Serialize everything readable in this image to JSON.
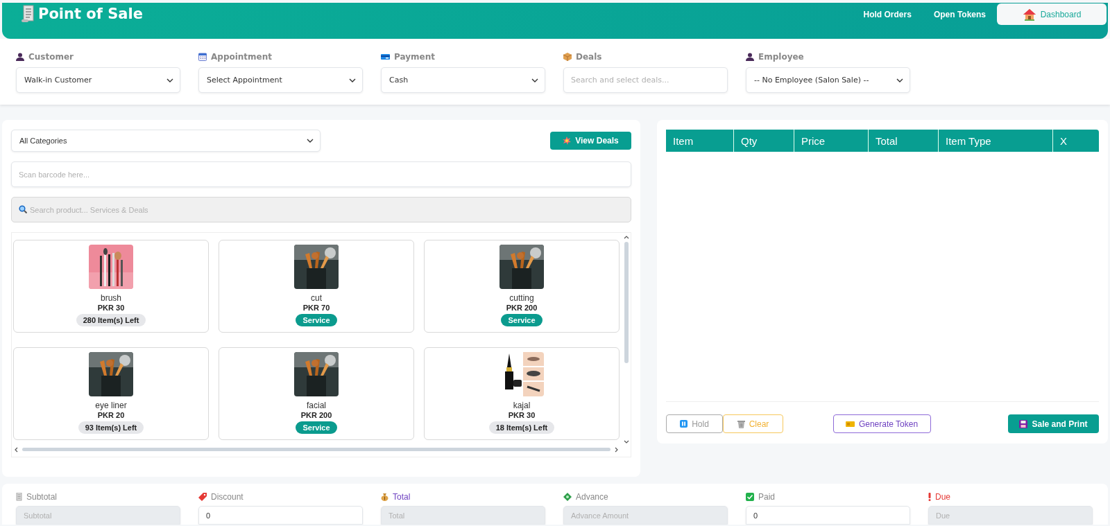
{
  "header": {
    "title": "Point of Sale",
    "nav": [
      {
        "label": "Hold Orders",
        "kind": "link"
      },
      {
        "label": "Open Tokens",
        "kind": "link"
      },
      {
        "label": "Dashboard",
        "kind": "button"
      }
    ]
  },
  "filters": [
    {
      "label": "Customer",
      "kind": "select",
      "value": "Walk-in Customer"
    },
    {
      "label": "Appointment",
      "kind": "select",
      "value": "Select Appointment"
    },
    {
      "label": "Payment",
      "kind": "select",
      "value": "Cash"
    },
    {
      "label": "Deals",
      "kind": "search",
      "placeholder": "Search and select deals..."
    },
    {
      "label": "Employee",
      "kind": "select",
      "value": "-- No Employee (Salon Sale) --"
    }
  ],
  "products_panel": {
    "category": "All Categories",
    "view_deals": "View Deals",
    "barcode_placeholder": "Scan barcode here...",
    "search_placeholder": "Search product... Services & Deals",
    "products": [
      {
        "name": "brush",
        "price": "PKR 30",
        "kind": "stock",
        "badge": "280 Item(s) Left"
      },
      {
        "name": "cut",
        "price": "PKR 70",
        "kind": "service",
        "badge": "Service"
      },
      {
        "name": "cutting",
        "price": "PKR 200",
        "kind": "service",
        "badge": "Service"
      },
      {
        "name": "eye liner",
        "price": "PKR 20",
        "kind": "stock",
        "badge": "93 Item(s) Left"
      },
      {
        "name": "facial",
        "price": "PKR 200",
        "kind": "service",
        "badge": "Service"
      },
      {
        "name": "kajal",
        "price": "PKR 30",
        "kind": "stock",
        "badge": "18 Item(s) Left"
      }
    ]
  },
  "cart": {
    "columns": [
      "Item",
      "Qty",
      "Price",
      "Total",
      "Item Type",
      "X"
    ],
    "buttons": [
      {
        "label": "Hold",
        "kind": "hold"
      },
      {
        "label": "Clear",
        "kind": "clear"
      },
      {
        "label": "Generate Token",
        "kind": "token"
      },
      {
        "label": "Sale and Print",
        "kind": "sale"
      }
    ]
  },
  "summary": [
    {
      "label": "Subtotal",
      "color": "#888888",
      "placeholder": "Subtotal",
      "readonly": true
    },
    {
      "label": "Discount",
      "color": "#888888",
      "value": "0",
      "readonly": false
    },
    {
      "label": "Total",
      "color": "#6f42c1",
      "placeholder": "Total",
      "readonly": true
    },
    {
      "label": "Advance",
      "color": "#888888",
      "placeholder": "Advance Amount",
      "readonly": true
    },
    {
      "label": "Paid",
      "color": "#888888",
      "value": "0",
      "readonly": false
    },
    {
      "label": "Due",
      "color": "#e53935",
      "placeholder": "Due",
      "readonly": true
    }
  ]
}
